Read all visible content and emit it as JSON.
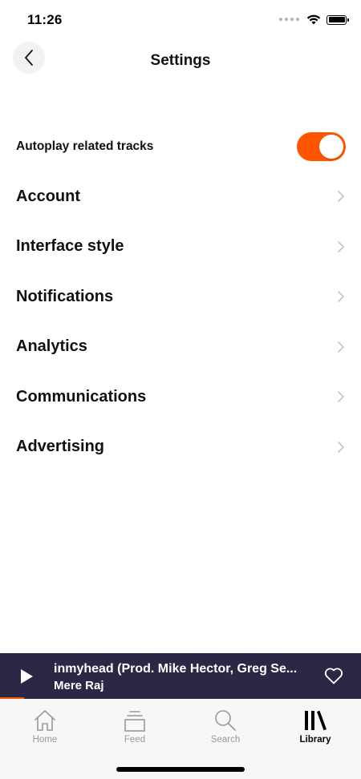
{
  "status_bar": {
    "time": "11:26",
    "signal_icon": "signal-dots-icon",
    "wifi_icon": "wifi-icon",
    "battery_icon": "battery-icon"
  },
  "header": {
    "back_icon": "chevron-left-icon",
    "title": "Settings"
  },
  "settings": {
    "autoplay": {
      "label": "Autoplay related tracks",
      "enabled": true
    },
    "items": [
      {
        "label": "Account"
      },
      {
        "label": "Interface style"
      },
      {
        "label": "Notifications"
      },
      {
        "label": "Analytics"
      },
      {
        "label": "Communications"
      },
      {
        "label": "Advertising"
      }
    ]
  },
  "mini_player": {
    "title": "inmyhead (Prod. Mike Hector, Greg Se...",
    "artist": "Mere Raj",
    "play_icon": "play-icon",
    "like_icon": "heart-outline-icon"
  },
  "tab_bar": {
    "tabs": [
      {
        "label": "Home",
        "icon": "home-icon",
        "active": false
      },
      {
        "label": "Feed",
        "icon": "feed-icon",
        "active": false
      },
      {
        "label": "Search",
        "icon": "search-icon",
        "active": false
      },
      {
        "label": "Library",
        "icon": "library-icon",
        "active": true
      }
    ]
  },
  "colors": {
    "accent": "#ff5500",
    "player_background": "#2a2845",
    "tab_bar_background": "#f7f7f7",
    "inactive_tab": "#9a9a9a"
  }
}
